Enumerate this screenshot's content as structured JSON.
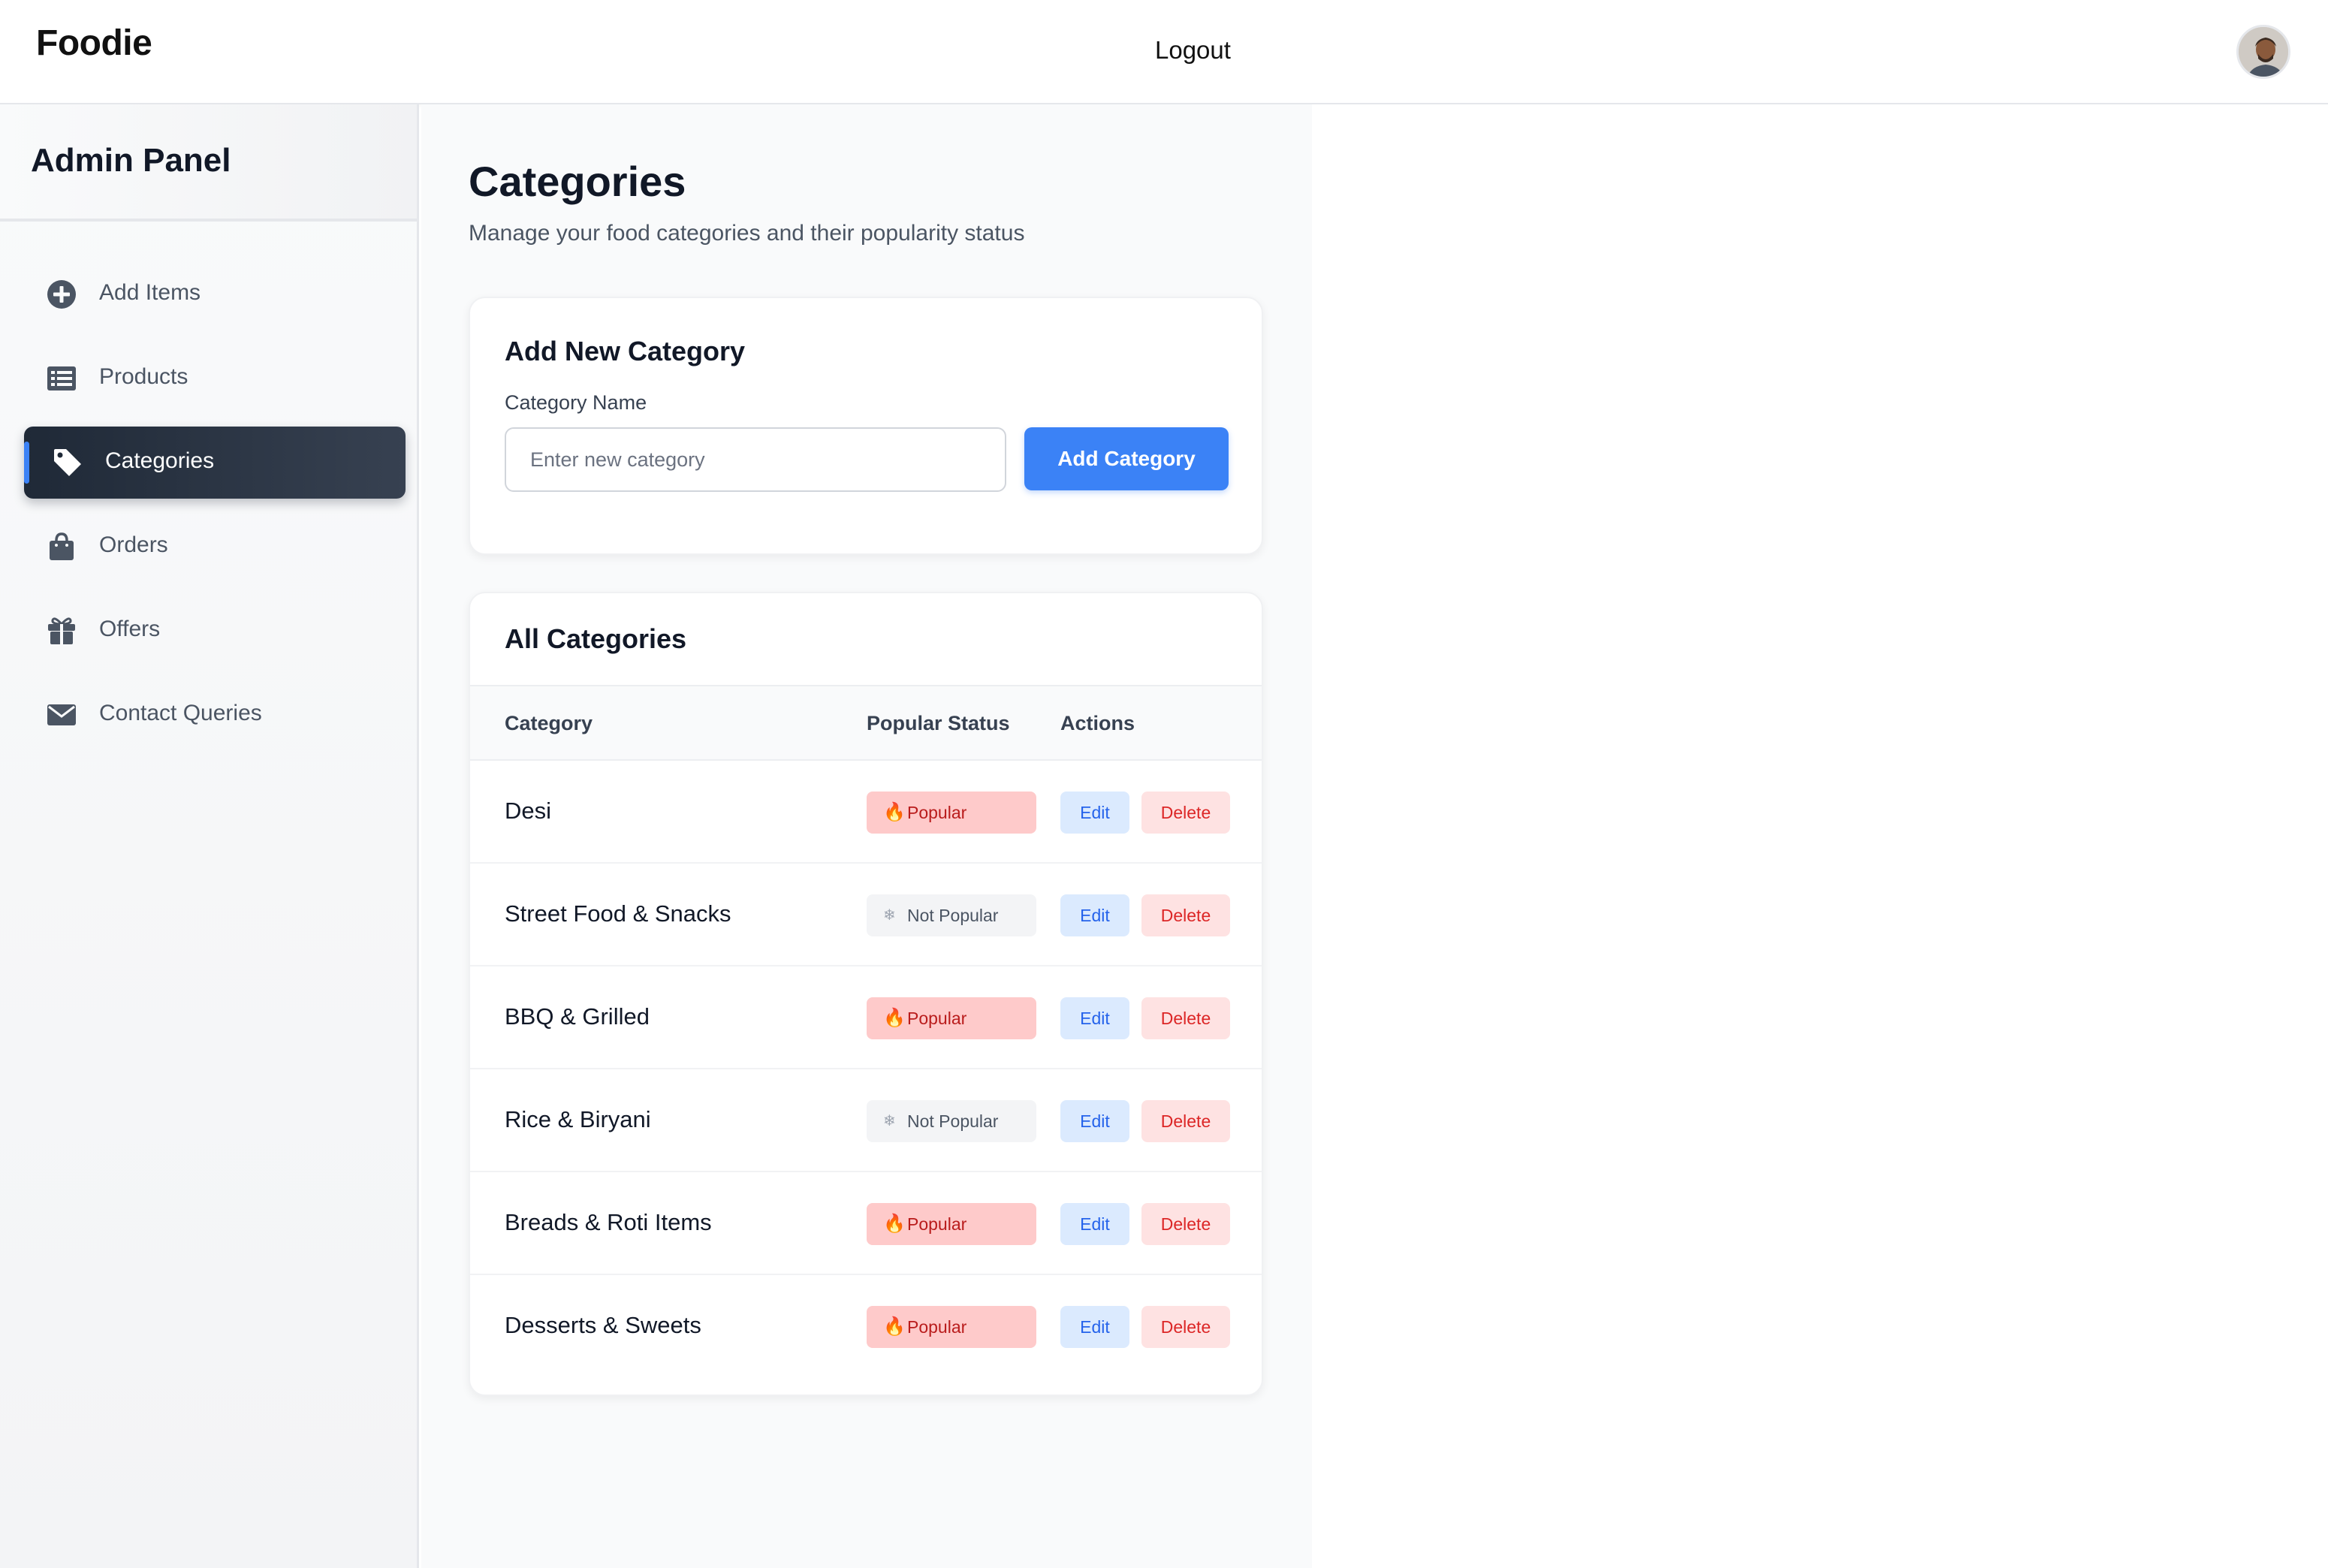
{
  "header": {
    "brand": "Foodie",
    "logout_label": "Logout",
    "avatar_icon": "user-avatar"
  },
  "sidebar": {
    "title": "Admin Panel",
    "items": [
      {
        "label": "Add Items",
        "icon": "plus-circle-icon",
        "active": false
      },
      {
        "label": "Products",
        "icon": "list-icon",
        "active": false
      },
      {
        "label": "Categories",
        "icon": "tag-icon",
        "active": true
      },
      {
        "label": "Orders",
        "icon": "shopping-bag-icon",
        "active": false
      },
      {
        "label": "Offers",
        "icon": "gift-icon",
        "active": false
      },
      {
        "label": "Contact Queries",
        "icon": "envelope-icon",
        "active": false
      }
    ]
  },
  "main": {
    "title": "Categories",
    "subtitle": "Manage your food categories and their popularity status",
    "add_card": {
      "title": "Add New Category",
      "field_label": "Category Name",
      "input_placeholder": "Enter new category",
      "input_value": "",
      "button_label": "Add Category"
    },
    "list_card": {
      "title": "All Categories",
      "columns": [
        "Category",
        "Popular Status",
        "Actions"
      ],
      "rows": [
        {
          "name": "Desi",
          "status": "Popular",
          "popular": true
        },
        {
          "name": "Street Food & Snacks",
          "status": "Not Popular",
          "popular": false
        },
        {
          "name": "BBQ & Grilled",
          "status": "Popular",
          "popular": true
        },
        {
          "name": "Rice & Biryani",
          "status": "Not Popular",
          "popular": false
        },
        {
          "name": "Breads & Roti Items",
          "status": "Popular",
          "popular": true
        },
        {
          "name": "Desserts & Sweets",
          "status": "Popular",
          "popular": true
        }
      ],
      "edit_label": "Edit",
      "delete_label": "Delete",
      "popular_icon": "fire-icon",
      "not_popular_icon": "snowflake-icon"
    }
  },
  "colors": {
    "accent": "#3b82f6",
    "sidebar_active": "#1f2937",
    "popular_bg": "#fecaca",
    "popular_text": "#b91c1c",
    "not_popular_bg": "#f3f4f6",
    "edit_bg": "#dbeafe",
    "delete_bg": "#fee2e2"
  }
}
